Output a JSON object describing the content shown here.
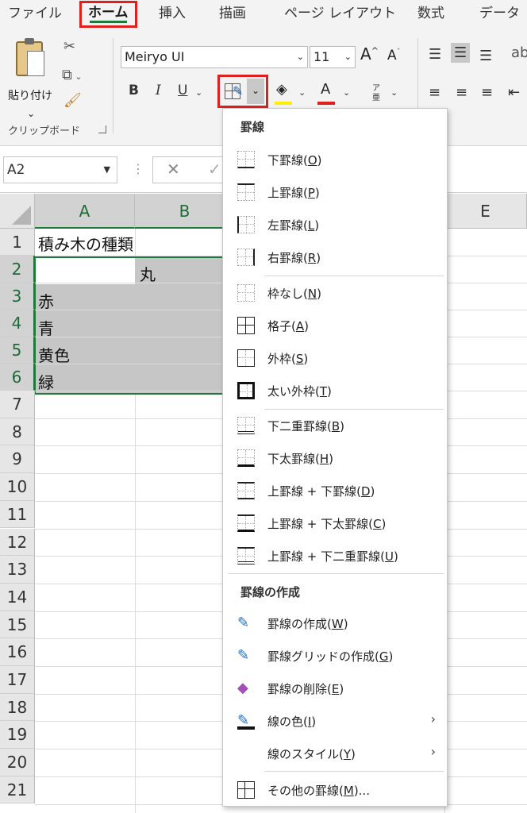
{
  "tabs": [
    "ファイル",
    "ホーム",
    "挿入",
    "描画",
    "ページ レイアウト",
    "数式",
    "データ"
  ],
  "clipboard": {
    "paste_label": "貼り付け",
    "group_label": "クリップボード"
  },
  "font": {
    "name": "Meiryo UI",
    "size": "11",
    "bold": "B",
    "italic": "I",
    "underline": "U",
    "grow": "A",
    "shrink": "A",
    "font_color_letter": "A",
    "phonetic": "ア亜"
  },
  "colors": {
    "accent_red": "#e0201f",
    "excel_green": "#1d7a3a",
    "fill_yellow": "#ffee00",
    "font_red": "#e0201f"
  },
  "namebox": {
    "value": "A2"
  },
  "columns": [
    "A",
    "B",
    "E"
  ],
  "rows": [
    "1",
    "2",
    "3",
    "4",
    "5",
    "6",
    "7",
    "8",
    "9",
    "10",
    "11",
    "12",
    "13",
    "14",
    "15",
    "16",
    "17",
    "18",
    "19",
    "20",
    "21"
  ],
  "cells": {
    "a1": "積み木の種類",
    "b2": "丸",
    "a3": "赤",
    "a4": "青",
    "a5": "黄色",
    "a6": "緑"
  },
  "menu": {
    "header1": "罫線",
    "items1": [
      {
        "text": "下罫線(",
        "key": "O",
        "icon": "bottom-border-icon"
      },
      {
        "text": "上罫線(",
        "key": "P",
        "icon": "top-border-icon"
      },
      {
        "text": "左罫線(",
        "key": "L",
        "icon": "left-border-icon"
      },
      {
        "text": "右罫線(",
        "key": "R",
        "icon": "right-border-icon"
      }
    ],
    "items2": [
      {
        "text": "枠なし(",
        "key": "N",
        "icon": "no-border-icon"
      },
      {
        "text": "格子(",
        "key": "A",
        "icon": "all-borders-icon"
      },
      {
        "text": "外枠(",
        "key": "S",
        "icon": "outside-borders-icon"
      },
      {
        "text": "太い外枠(",
        "key": "T",
        "icon": "thick-box-border-icon"
      }
    ],
    "items3": [
      {
        "text": "下二重罫線(",
        "key": "B",
        "icon": "bottom-double-border-icon"
      },
      {
        "text": "下太罫線(",
        "key": "H",
        "icon": "thick-bottom-border-icon"
      },
      {
        "text": "上罫線 + 下罫線(",
        "key": "D",
        "icon": "top-bottom-border-icon"
      },
      {
        "text": "上罫線 + 下太罫線(",
        "key": "C",
        "icon": "top-thick-bottom-border-icon"
      },
      {
        "text": "上罫線 + 下二重罫線(",
        "key": "U",
        "icon": "top-double-bottom-border-icon"
      }
    ],
    "header2": "罫線の作成",
    "items4": [
      {
        "text": "罫線の作成(",
        "key": "W",
        "icon": "draw-border-icon"
      },
      {
        "text": "罫線グリッドの作成(",
        "key": "G",
        "icon": "draw-border-grid-icon"
      },
      {
        "text": "罫線の削除(",
        "key": "E",
        "icon": "erase-border-icon"
      },
      {
        "text": "線の色(",
        "key": "I",
        "icon": "line-color-icon"
      },
      {
        "text": "線のスタイル(",
        "key": "Y",
        "icon": "line-style-icon"
      }
    ],
    "more": {
      "text": "その他の罫線(",
      "key": "M",
      "suffix": ")...",
      "icon": "more-borders-icon"
    }
  }
}
